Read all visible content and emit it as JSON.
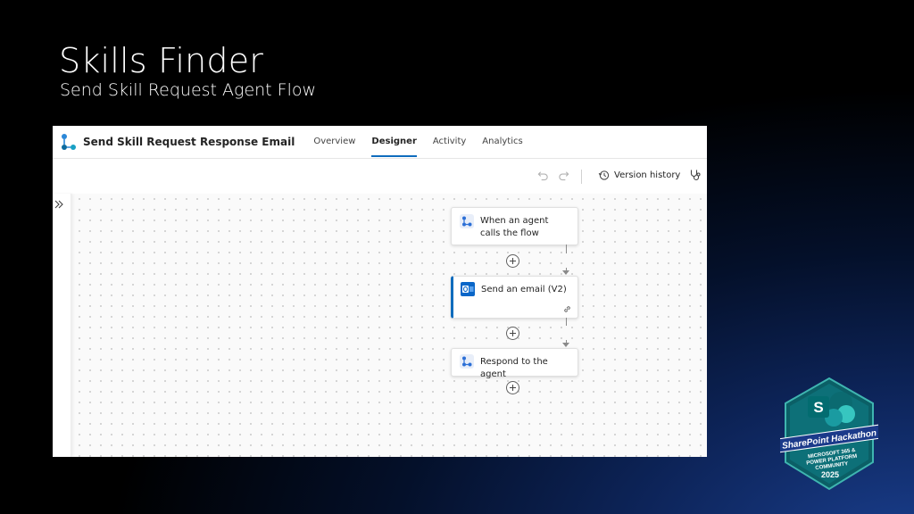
{
  "slide": {
    "title": "Skills Finder",
    "subtitle": "Send Skill Request Agent Flow"
  },
  "app": {
    "flow_name": "Send Skill Request Response Email",
    "tabs": [
      {
        "label": "Overview",
        "active": false
      },
      {
        "label": "Designer",
        "active": true
      },
      {
        "label": "Activity",
        "active": false
      },
      {
        "label": "Analytics",
        "active": false
      }
    ],
    "toolbar": {
      "version_history_label": "Version history"
    },
    "nodes": [
      {
        "label": "When an agent calls the flow",
        "icon": "agent-flow-icon"
      },
      {
        "label": "Send an email (V2)",
        "icon": "outlook-icon",
        "selected": true
      },
      {
        "label": "Respond to the agent",
        "icon": "agent-flow-icon"
      }
    ],
    "accent_color": "#0f6cbd"
  },
  "badge": {
    "line1": "SharePoint Hackathon",
    "line2": "MICROSOFT 365 &",
    "line3": "POWER PLATFORM",
    "line4": "COMMUNITY",
    "year": "2025",
    "colors": {
      "teal": "#0b6a70",
      "light_teal": "#3fb5b0",
      "navy": "#1b3a8a"
    }
  }
}
